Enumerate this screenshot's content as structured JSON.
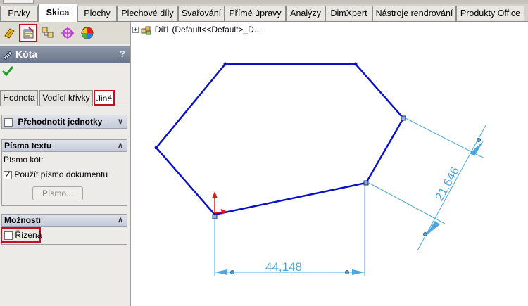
{
  "command_tabs": [
    "Prvky",
    "Skica",
    "Plochy",
    "Plechové díly",
    "Svařování",
    "Přímé úpravy",
    "Analýzy",
    "DimXpert",
    "Nástroje rendrování",
    "Produkty Office"
  ],
  "active_tab": "Skica",
  "manager_tabs": [
    "feature-manager-icon",
    "property-manager-icon",
    "configuration-manager-icon",
    "dimxpert-manager-icon",
    "display-manager-icon"
  ],
  "property_manager": {
    "title": "Kóta",
    "help": "?",
    "subtabs": [
      "Hodnota",
      "Vodící křivky",
      "Jiné"
    ],
    "active_subtab": "Jiné",
    "override_units_label": "Přehodnotit jednotky",
    "text_fonts": {
      "header": "Písma textu",
      "dimension_font_label": "Písmo kót:",
      "use_document_font_label": "Použít písmo dokumentu",
      "use_document_font_checked": true,
      "font_button": "Písmo..."
    },
    "options": {
      "header": "Možnosti",
      "driven_label": "Řízená",
      "driven_checked": false
    }
  },
  "tree": {
    "expand": "+",
    "text": "Díl1  (Default<<Default>_D..."
  },
  "dimensions": {
    "horizontal": "44,148",
    "aligned": "21,646"
  },
  "colors": {
    "sketch": "#0a12c9",
    "dimension": "#4da6dc",
    "highlight": "#c1121f"
  }
}
